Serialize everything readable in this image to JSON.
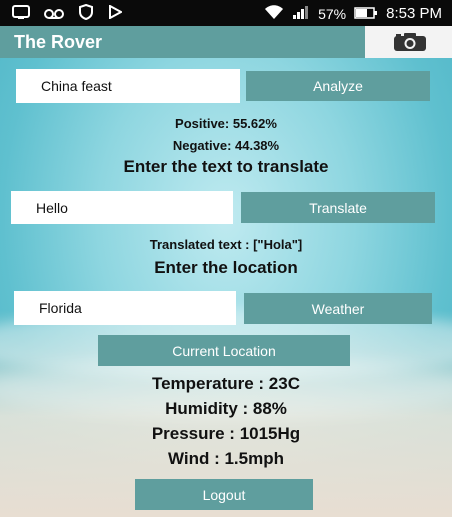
{
  "status_bar": {
    "battery": "57%",
    "time": "8:53 PM"
  },
  "app": {
    "title": "The Rover"
  },
  "sentiment": {
    "input_value": "China feast",
    "analyze_label": "Analyze",
    "positive": "Positive: 55.62%",
    "negative": "Negative: 44.38%"
  },
  "translate": {
    "heading": "Enter the text to translate",
    "input_value": "Hello",
    "button_label": "Translate",
    "result": "Translated text : [\"Hola\"]"
  },
  "weather": {
    "heading": "Enter the location",
    "input_value": "Florida",
    "button_label": "Weather",
    "current_location_label": "Current Location",
    "temperature": "Temperature : 23C",
    "humidity": "Humidity : 88%",
    "pressure": "Pressure : 1015Hg",
    "wind": "Wind : 1.5mph"
  },
  "logout_label": "Logout",
  "colors": {
    "accent": "#5f9e9e",
    "status_bar": "#0a0a0a"
  },
  "icons": [
    "tv-icon",
    "voicemail-icon",
    "shield-icon",
    "play-icon",
    "wifi-icon",
    "signal-icon",
    "battery-icon",
    "camera-icon"
  ]
}
